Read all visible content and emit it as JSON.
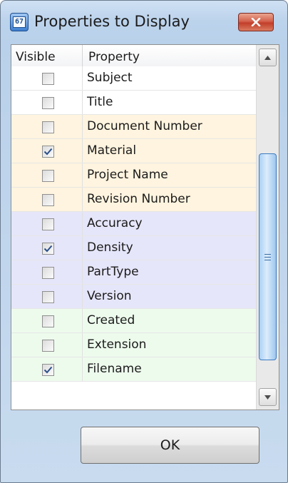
{
  "window": {
    "title": "Properties to Display",
    "icon": "properties-dialog-icon",
    "close_icon": "close-icon"
  },
  "list": {
    "columns": [
      "Visible",
      "Property"
    ],
    "rows": [
      {
        "label": "Subject",
        "checked": false,
        "bg": "#ffffff"
      },
      {
        "label": "Title",
        "checked": false,
        "bg": "#ffffff"
      },
      {
        "label": "Document Number",
        "checked": false,
        "bg": "#fff4df"
      },
      {
        "label": "Material",
        "checked": true,
        "bg": "#fff4df"
      },
      {
        "label": "Project Name",
        "checked": false,
        "bg": "#fff4df"
      },
      {
        "label": "Revision Number",
        "checked": false,
        "bg": "#fff4df"
      },
      {
        "label": "Accuracy",
        "checked": false,
        "bg": "#e6e6fa"
      },
      {
        "label": "Density",
        "checked": true,
        "bg": "#e6e6fa"
      },
      {
        "label": "PartType",
        "checked": false,
        "bg": "#e6e6fa"
      },
      {
        "label": "Version",
        "checked": false,
        "bg": "#e6e6fa"
      },
      {
        "label": "Created",
        "checked": false,
        "bg": "#edfbed"
      },
      {
        "label": "Extension",
        "checked": false,
        "bg": "#edfbed"
      },
      {
        "label": "Filename",
        "checked": true,
        "bg": "#edfbed"
      }
    ],
    "scroll_offset_fraction": 0.12
  },
  "buttons": {
    "ok_label": "OK"
  }
}
